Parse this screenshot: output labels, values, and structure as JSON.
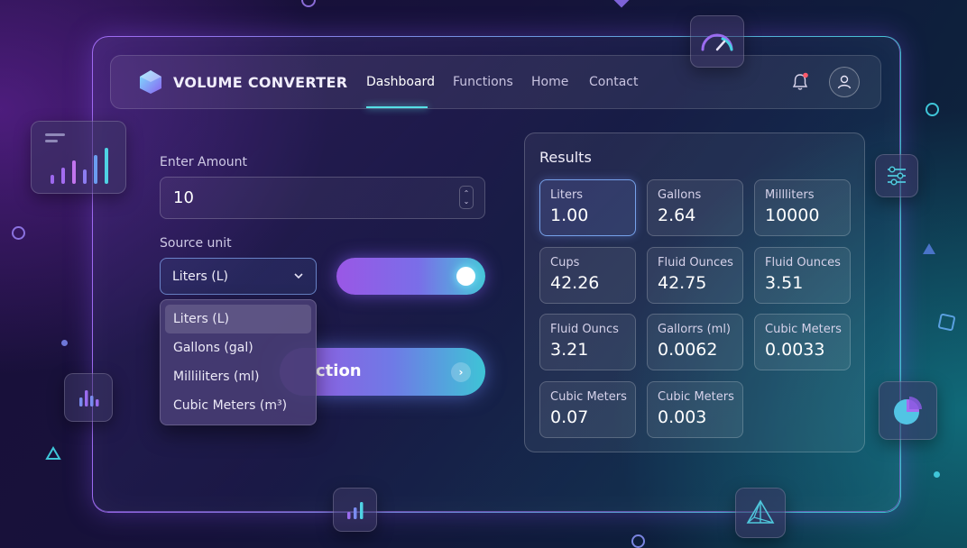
{
  "app": {
    "title": "VOLUME CONVERTER"
  },
  "nav": {
    "items": [
      {
        "label": "Dashboard"
      },
      {
        "label": "Functions"
      },
      {
        "label": "Home"
      },
      {
        "label": "Contact"
      }
    ],
    "active": "Dashboard"
  },
  "form": {
    "amount_label": "Enter Amount",
    "amount_value": "10",
    "source_label": "Source unit",
    "source_selected": "Liters (L)",
    "source_options": [
      "Liters (L)",
      "Gallons (gal)",
      "Milliliters (ml)",
      "Cubic Meters (m³)"
    ],
    "action_label_visible": "ction",
    "action_arrow": "›"
  },
  "results": {
    "title": "Results",
    "items": [
      {
        "name": "Liters",
        "value": "1.00"
      },
      {
        "name": "Gallons",
        "value": "2.64"
      },
      {
        "name": "Millliters",
        "value": "10000"
      },
      {
        "name": "Cups",
        "value": "42.26"
      },
      {
        "name": "Fluid Ounces",
        "value": "42.75"
      },
      {
        "name": "Fluid Ounces",
        "value": "3.51"
      },
      {
        "name": "Fluid Ouncs",
        "value": "3.21"
      },
      {
        "name": "Gallorrs (ml)",
        "value": "0.0062"
      },
      {
        "name": "Cubic Meters",
        "value": "0.0033"
      },
      {
        "name": "Cubic Meters",
        "value": "0.07"
      },
      {
        "name": "Cubic Meters",
        "value": "0.003"
      }
    ]
  },
  "icons": {
    "logo": "cube-icon",
    "notification": "bell-icon",
    "profile": "user-icon",
    "gauge": "speedometer-icon",
    "chart": "bar-chart-icon",
    "filters": "sliders-icon",
    "pie": "pie-chart-icon",
    "pyramid": "pyramid-icon"
  },
  "colors": {
    "accent_purple": "#9a57e6",
    "accent_cyan": "#45c6d8",
    "notification_dot": "#ff5a6a"
  }
}
